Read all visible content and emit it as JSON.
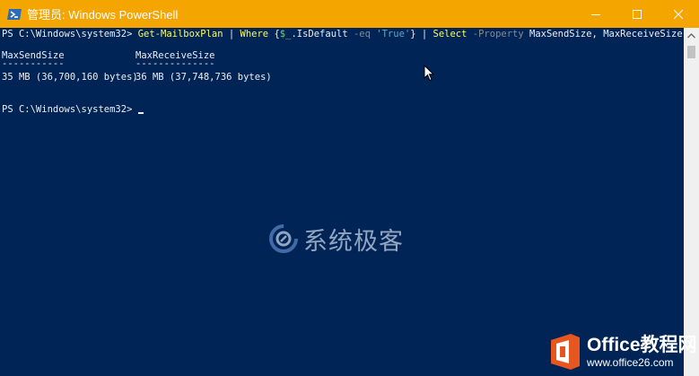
{
  "window": {
    "title": "管理员: Windows PowerShell",
    "accent_color": "#f5a500",
    "console_bg": "#012456",
    "icons": {
      "app": "powershell-icon",
      "minimize": "minimize-icon",
      "maximize": "maximize-icon",
      "close": "close-icon"
    }
  },
  "console": {
    "command_line": {
      "prompt": "PS C:\\Windows\\system32> ",
      "tokens": {
        "cmd1": "Get-MailboxPlan",
        "pipe1": " | ",
        "cmd2": "Where",
        "brace_open": " {",
        "var": "$_",
        "member": ".IsDefault ",
        "param1": "-eq",
        "space1": " ",
        "string": "'True'",
        "brace_close": "}",
        "pipe2": " | ",
        "cmd3": "Select",
        "space2": " ",
        "param2": "-Property",
        "args": " MaxSendSize, MaxReceiveSize"
      }
    },
    "table": {
      "headers": [
        "MaxSendSize",
        "MaxReceiveSize"
      ],
      "underlines": [
        "-----------",
        "--------------"
      ],
      "rows": [
        [
          "35 MB (36,700,160 bytes)",
          "36 MB (37,748,736 bytes)"
        ]
      ]
    },
    "second_prompt": "PS C:\\Windows\\system32> "
  },
  "watermarks": {
    "center": "系统极客",
    "corner_name": "Office教程网",
    "corner_url": "www.office26.com"
  }
}
